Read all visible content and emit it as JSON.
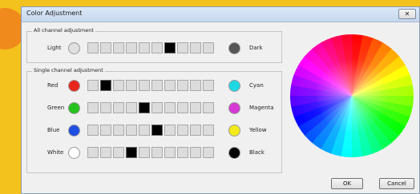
{
  "window": {
    "title": "Color Adjustment",
    "close_label": "✕"
  },
  "all_channel": {
    "group_label": "All channel adjustment",
    "row": {
      "left_label": "Light",
      "right_label": "Dark",
      "left_color": "#e0e0e0",
      "right_color": "#555555",
      "steps": 10,
      "selected": 6
    }
  },
  "single_channel": {
    "group_label": "Single channel adjustment",
    "rows": [
      {
        "left_label": "Red",
        "right_label": "Cyan",
        "left_color": "#e8261c",
        "right_color": "#1fd8e6",
        "steps": 10,
        "selected": 1
      },
      {
        "left_label": "Green",
        "right_label": "Magenta",
        "left_color": "#25c21f",
        "right_color": "#d53bd3",
        "steps": 10,
        "selected": 4
      },
      {
        "left_label": "Blue",
        "right_label": "Yellow",
        "left_color": "#1f4fe0",
        "right_color": "#f3ea1a",
        "steps": 10,
        "selected": 5
      },
      {
        "left_label": "White",
        "right_label": "Black",
        "left_color": "#ffffff",
        "right_color": "#000000",
        "steps": 10,
        "selected": 3
      }
    ]
  },
  "buttons": {
    "ok": "OK",
    "cancel": "Cancel"
  },
  "icons": {
    "close": "close-icon"
  }
}
